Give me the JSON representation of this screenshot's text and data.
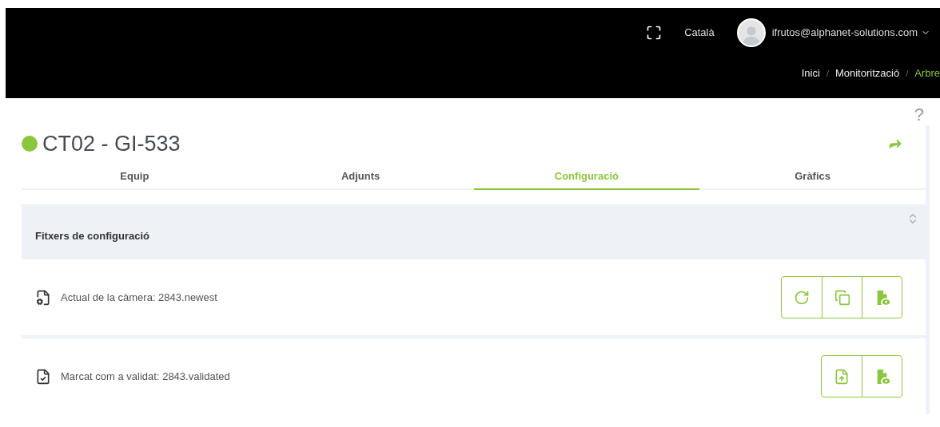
{
  "header": {
    "language": "Català",
    "user": "ifrutos@alphanet-solutions.com",
    "breadcrumb_separator": "/",
    "breadcrumb": [
      {
        "label": "Inici",
        "selected": false
      },
      {
        "label": "Monitorització",
        "selected": false
      },
      {
        "label": "Arbre",
        "selected": true
      }
    ]
  },
  "device": {
    "title": "CT02 - GI-533",
    "online": true,
    "help": "?"
  },
  "tabs": [
    {
      "label": "Equip",
      "selected": false
    },
    {
      "label": "Adjunts",
      "selected": false
    },
    {
      "label": "Configuració",
      "selected": true
    },
    {
      "label": "Gràfics",
      "selected": false
    }
  ],
  "section": {
    "title": "Fitxers de configuració",
    "expanded": true
  },
  "files": [
    {
      "kind": "settings",
      "label": "Actual de la càmera: 2843.newest",
      "actions": [
        {
          "kind": "refresh"
        },
        {
          "kind": "copy"
        },
        {
          "kind": "view"
        }
      ]
    },
    {
      "kind": "validated",
      "label": "Marcat com a validat: 2843.validated",
      "actions": [
        {
          "kind": "upload"
        },
        {
          "kind": "view"
        }
      ]
    }
  ]
}
